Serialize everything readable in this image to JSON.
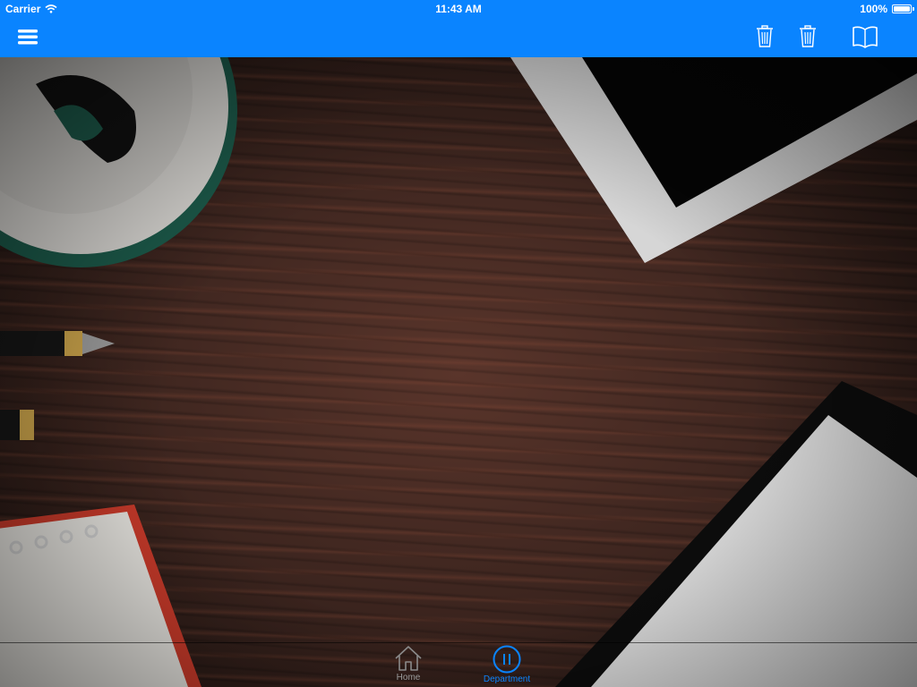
{
  "status_bar": {
    "carrier": "Carrier",
    "time": "11:43 AM",
    "battery_percent": "100%",
    "battery_level": 1.0
  },
  "nav_bar": {
    "background_color": "#0a84ff",
    "left_icon": "menu-icon",
    "right_icons": [
      "trash-icon",
      "trash-icon",
      "book-icon"
    ]
  },
  "background": {
    "description_icon": "desk-photo"
  },
  "tab_bar": {
    "accent_color": "#0a84ff",
    "inactive_color": "#9a9a9a",
    "selected_tab": "Department",
    "tabs": [
      {
        "label": "Home",
        "icon": "home-icon",
        "selected": false
      },
      {
        "label": "Department",
        "icon": "pause-circle-icon",
        "selected": true
      }
    ]
  }
}
